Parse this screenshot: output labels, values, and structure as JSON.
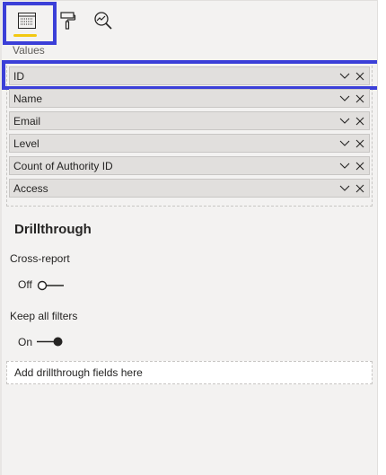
{
  "toolbar": {
    "tools": [
      {
        "name": "fields-icon",
        "active": true
      },
      {
        "name": "format-paint-roller-icon",
        "active": false
      },
      {
        "name": "analytics-magnifier-icon",
        "active": false
      }
    ],
    "active_color": "#f2c811",
    "highlight_color": "#3b3fd8"
  },
  "values": {
    "label": "Values",
    "fields": [
      {
        "label": "ID",
        "highlighted": true
      },
      {
        "label": "Name"
      },
      {
        "label": "Email"
      },
      {
        "label": "Level"
      },
      {
        "label": "Count of Authority ID"
      },
      {
        "label": "Access"
      }
    ]
  },
  "drillthrough": {
    "title": "Drillthrough",
    "cross_report": {
      "label": "Cross-report",
      "state_text": "Off",
      "on": false
    },
    "keep_all_filters": {
      "label": "Keep all filters",
      "state_text": "On",
      "on": true
    },
    "well_placeholder": "Add drillthrough fields here"
  }
}
